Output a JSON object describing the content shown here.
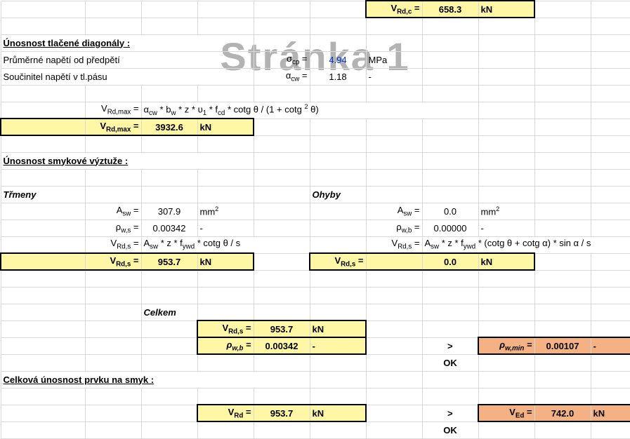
{
  "watermark": "Stránka 1",
  "vrdc": {
    "label": "V_Rd,c =",
    "value": "658.3",
    "unit": "kN"
  },
  "section1": {
    "heading": "Únosnost tlačené diagonály :",
    "row1": {
      "label": "Průměrné napětí od předpětí",
      "symbol": "σ_cp =",
      "value": "4.94",
      "unit": "MPa"
    },
    "row2": {
      "label": "Součinitel napětí v tl.pásu",
      "symbol": "α_cw =",
      "value": "1.18",
      "unit": "-"
    },
    "formula_sym": "V_Rd,max =",
    "formula_rhs": "α_cw * b_w * z * υ_1 * f_cd * cotg θ / (1 + cotg 2 θ)",
    "result": {
      "label": "V_Rd,max =",
      "value": "3932.6",
      "unit": "kN"
    }
  },
  "section2": {
    "heading": "Únosnost smykové výztuže :",
    "stirrups": {
      "title": "Třmeny",
      "asw_lbl": "A_sw =",
      "asw_val": "307.9",
      "asw_unit": "mm2",
      "rho_lbl": "ρ_w,s =",
      "rho_val": "0.00342",
      "rho_unit": "-",
      "vrds_formula_lbl": "V_Rd,s =",
      "vrds_formula": "A_sw * z * f_ywd * cotg θ / s",
      "vrds_lbl": "V_Rd,s =",
      "vrds_val": "953.7",
      "vrds_unit": "kN"
    },
    "bends": {
      "title": "Ohyby",
      "asw_lbl": "A_sw =",
      "asw_val": "0.0",
      "asw_unit": "mm2",
      "rho_lbl": "ρ_w,b =",
      "rho_val": "0.00000",
      "rho_unit": "-",
      "vrds_formula_lbl": "V_Rd,s =",
      "vrds_formula": "A_sw * z * f_ywd * (cotg θ + cotg α) * sin α / s",
      "vrds_lbl": "V_Rd,s =",
      "vrds_val": "0.0",
      "vrds_unit": "kN"
    },
    "total": {
      "title": "Celkem",
      "vrds_lbl": "V_Rd,s =",
      "vrds_val": "953.7",
      "vrds_unit": "kN",
      "rho_lbl": "ρ_w,b =",
      "rho_val": "0.00342",
      "rho_unit": "-",
      "cmp": ">",
      "ok": "OK",
      "rhomin_lbl": "ρ_w,min =",
      "rhomin_val": "0.00107",
      "rhomin_unit": "-"
    }
  },
  "section3": {
    "heading": "Celková únosnost prvku na smyk :",
    "vrd_lbl": "V_Rd =",
    "vrd_val": "953.7",
    "vrd_unit": "kN",
    "cmp": ">",
    "ok": "OK",
    "ved_lbl": "V_Ed =",
    "ved_val": "742.0",
    "ved_unit": "kN"
  }
}
